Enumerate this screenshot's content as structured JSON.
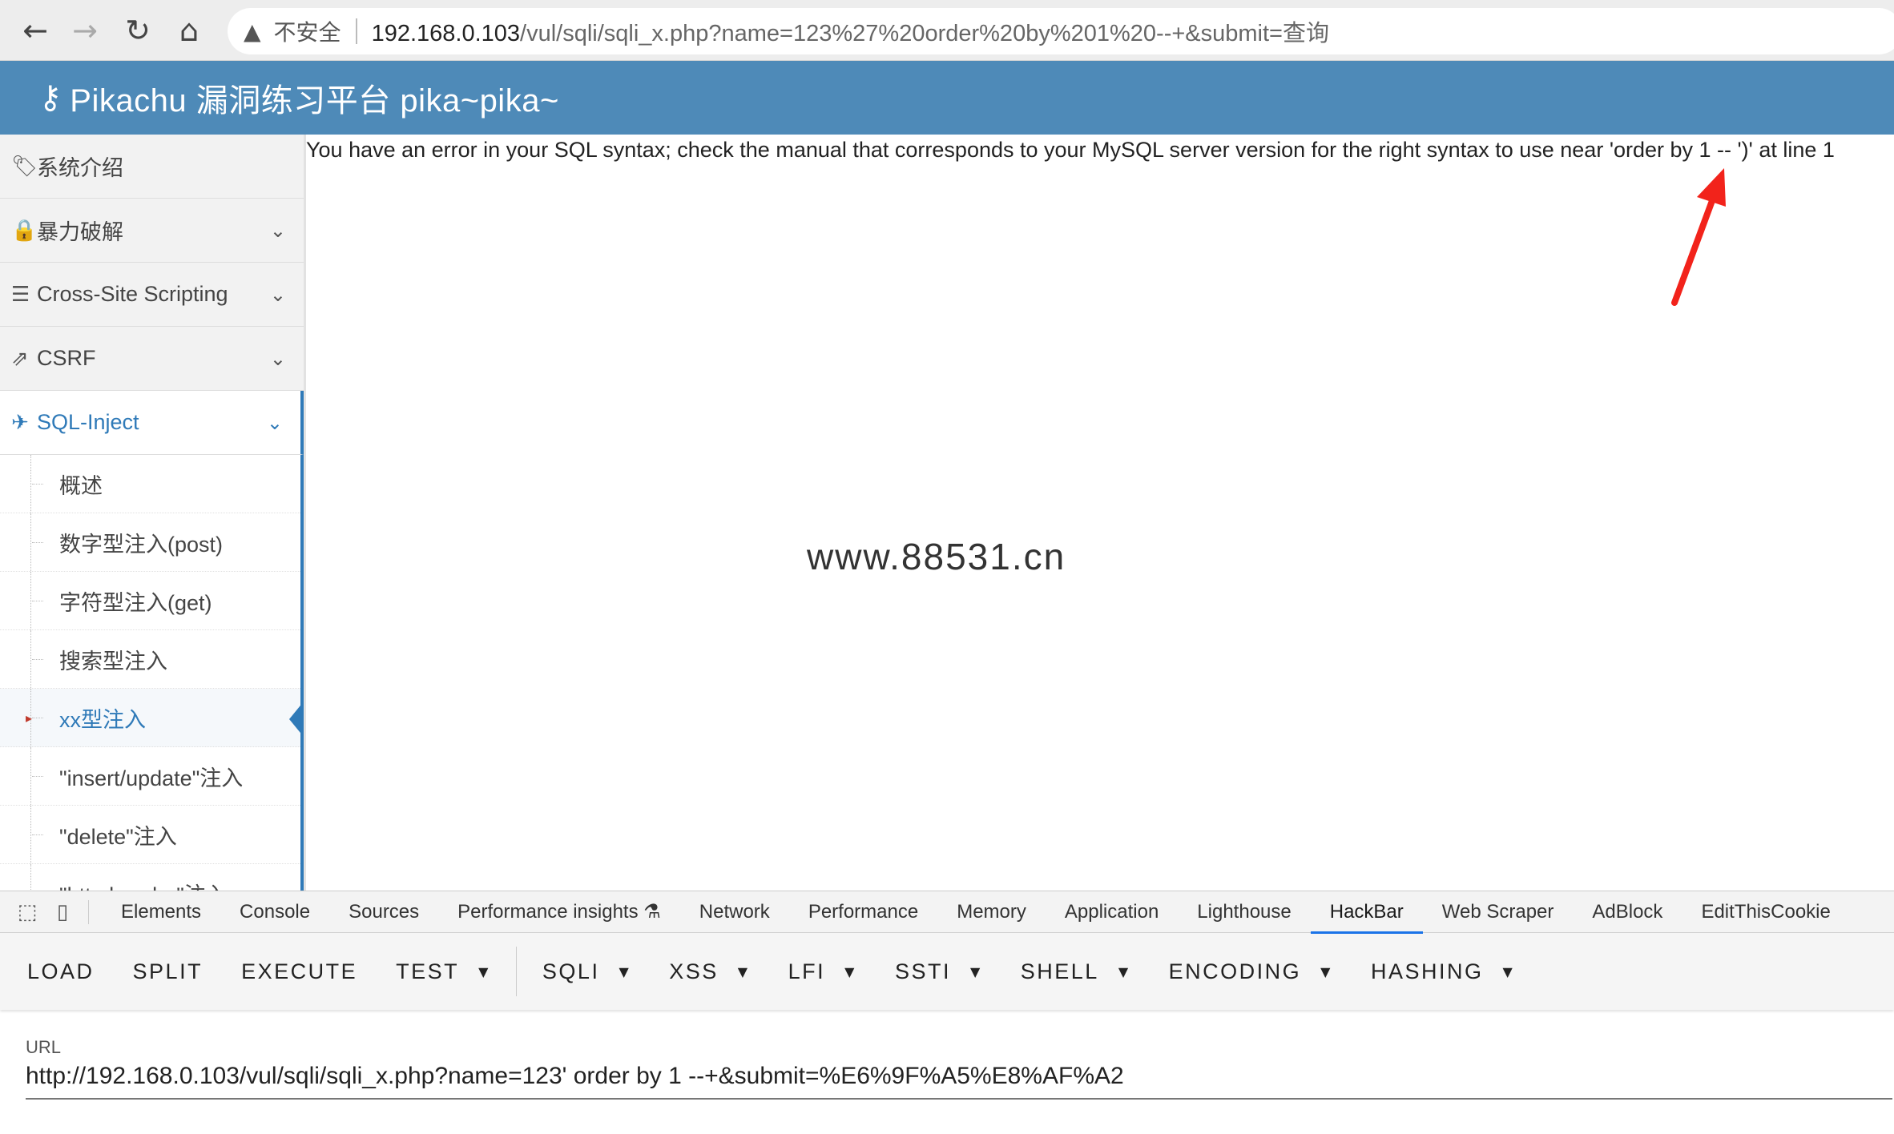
{
  "browser": {
    "back_icon": "←",
    "forward_icon": "→",
    "reload_icon": "↻",
    "home_icon": "⌂",
    "warning_icon": "▲",
    "insecure_label": "不安全",
    "url_host": "192.168.0.103",
    "url_path": "/vul/sqli/sqli_x.php?name=123%27%20order%20by%201%20--+&submit=查询"
  },
  "header": {
    "icon": "🔍",
    "title": "Pikachu 漏洞练习平台 pika~pika~"
  },
  "sidebar": {
    "items": [
      {
        "icon": "🏷",
        "label": "系统介绍"
      },
      {
        "icon": "🔒",
        "label": "暴力破解",
        "chevron": "⌄"
      },
      {
        "icon": "☰",
        "label": "Cross-Site Scripting",
        "chevron": "⌄"
      },
      {
        "icon": "⇗",
        "label": "CSRF",
        "chevron": "⌄"
      },
      {
        "icon": "✈",
        "label": "SQL-Inject",
        "chevron": "⌄"
      }
    ],
    "subitems": [
      {
        "label": "概述"
      },
      {
        "label": "数字型注入(post)"
      },
      {
        "label": "字符型注入(get)"
      },
      {
        "label": "搜索型注入"
      },
      {
        "label": "xx型注入",
        "bullet": "▸"
      },
      {
        "label": "\"insert/update\"注入"
      },
      {
        "label": "\"delete\"注入"
      },
      {
        "label": "\"http header\"注入"
      }
    ]
  },
  "main": {
    "error_text": "You have an error in your SQL syntax; check the manual that corresponds to your MySQL server version for the right syntax to use near 'order by 1 -- ')' at line 1",
    "watermark": "www.88531.cn",
    "arrow_color": "#f2231b"
  },
  "devtools": {
    "inspect_icon": "⬚",
    "device_icon": "▯",
    "tabs": [
      "Elements",
      "Console",
      "Sources",
      "Performance insights ⚗",
      "Network",
      "Performance",
      "Memory",
      "Application",
      "Lighthouse",
      "HackBar",
      "Web Scraper",
      "AdBlock",
      "EditThisCookie"
    ],
    "active_tab": "HackBar"
  },
  "hackbar": {
    "buttons": [
      "LOAD",
      "SPLIT",
      "EXECUTE",
      "TEST",
      "SQLI",
      "XSS",
      "LFI",
      "SSTI",
      "SHELL",
      "ENCODING",
      "HASHING"
    ],
    "caret": "▼",
    "url_label": "URL",
    "url_value": "http://192.168.0.103/vul/sqli/sqli_x.php?name=123' order by 1 --+&submit=%E6%9F%A5%E8%AF%A2"
  }
}
